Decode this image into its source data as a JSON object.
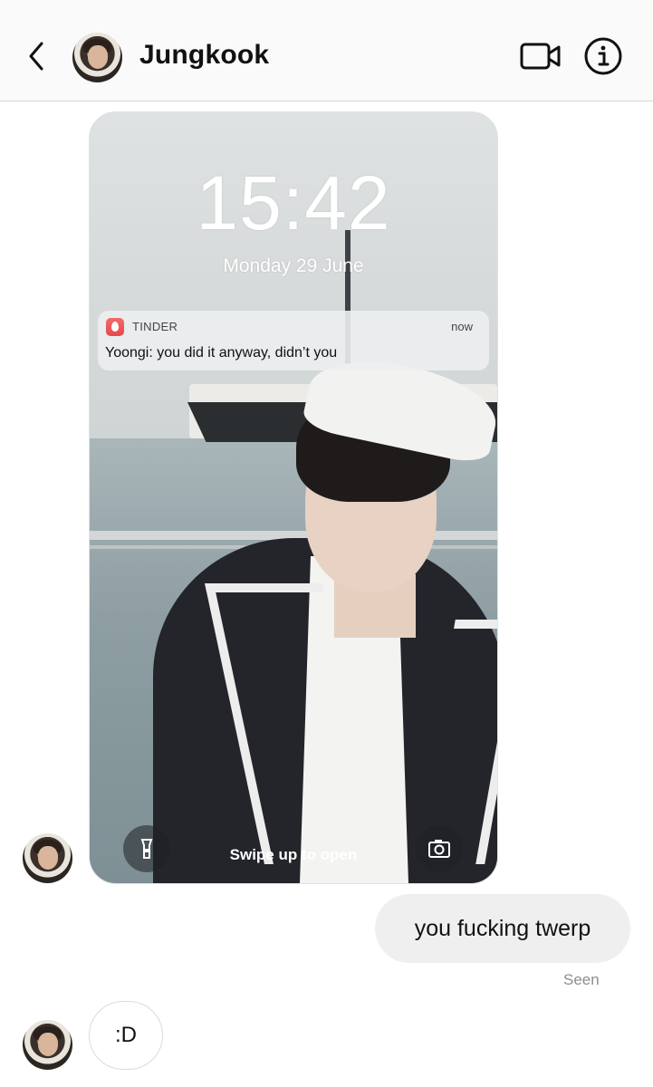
{
  "header": {
    "title": "Jungkook",
    "icons": [
      "back-arrow-icon",
      "avatar",
      "video-camera-icon",
      "info-icon"
    ]
  },
  "shared_screenshot": {
    "time": "15:42",
    "date": "Monday 29 June",
    "notification": {
      "app": "TINDER",
      "time": "now",
      "body": "Yoongi: you did it anyway, didn’t you"
    },
    "swipe_text": "Swipe up to open",
    "icons": [
      "flashlight-icon",
      "camera-icon"
    ]
  },
  "messages": {
    "outgoing": {
      "text": "you fucking twerp",
      "status": "Seen"
    },
    "incoming": {
      "text": ":D"
    }
  }
}
